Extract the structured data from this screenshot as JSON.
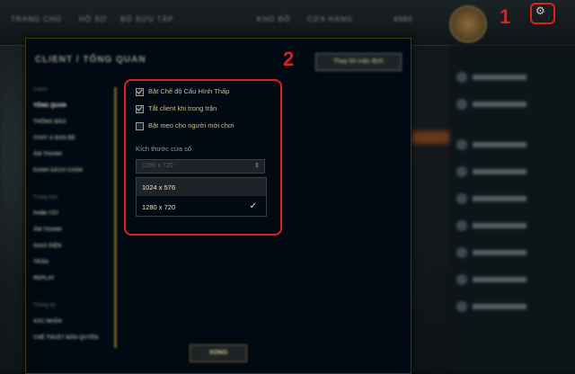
{
  "topbar": {
    "nav": [
      "TRANG CHỦ",
      "HỒ SƠ",
      "BỘ SƯU TẬP"
    ],
    "right_nav": [
      "KHO ĐỒ",
      "CỬA HÀNG"
    ],
    "currency": "4980"
  },
  "markers": {
    "one": "1",
    "two": "2"
  },
  "modal": {
    "breadcrumb": "CLIENT / TỔNG QUAN",
    "top_button": "Thay lời mặc định",
    "done": "XONG"
  },
  "sidebar": {
    "client_header": "Client",
    "client_items": [
      "TỔNG QUAN",
      "THÔNG BÁO",
      "CHAT & BẠN BÈ",
      "ÂM THANH",
      "DANH SÁCH CHẶN"
    ],
    "ingame_header": "Trong trận",
    "ingame_items": [
      "PHÍM TẮT",
      "ÂM THANH",
      "GIAO DIỆN",
      "TRẬN",
      "REPLAY"
    ],
    "other_header": "Thông tin",
    "other_items": [
      "XÁC NHẬN",
      "CHẾ THUẬT BẢN QUYỀN"
    ]
  },
  "settings": {
    "checkboxes": [
      {
        "label": "Bật Chế độ Cấu Hình Thấp",
        "checked": true
      },
      {
        "label": "Tắt client khi trong trận",
        "checked": true
      },
      {
        "label": "Bật mẹo cho người mới chơi",
        "checked": false
      }
    ],
    "window_size_label": "Kích thước cửa sổ",
    "window_size_selected": "1280 x 720",
    "window_size_options": [
      "1024 x 576",
      "1280 x 720"
    ],
    "checked_option": "1280 x 720"
  },
  "colors": {
    "accent_gold": "#cdbe91",
    "annotation_red": "#e02020"
  }
}
